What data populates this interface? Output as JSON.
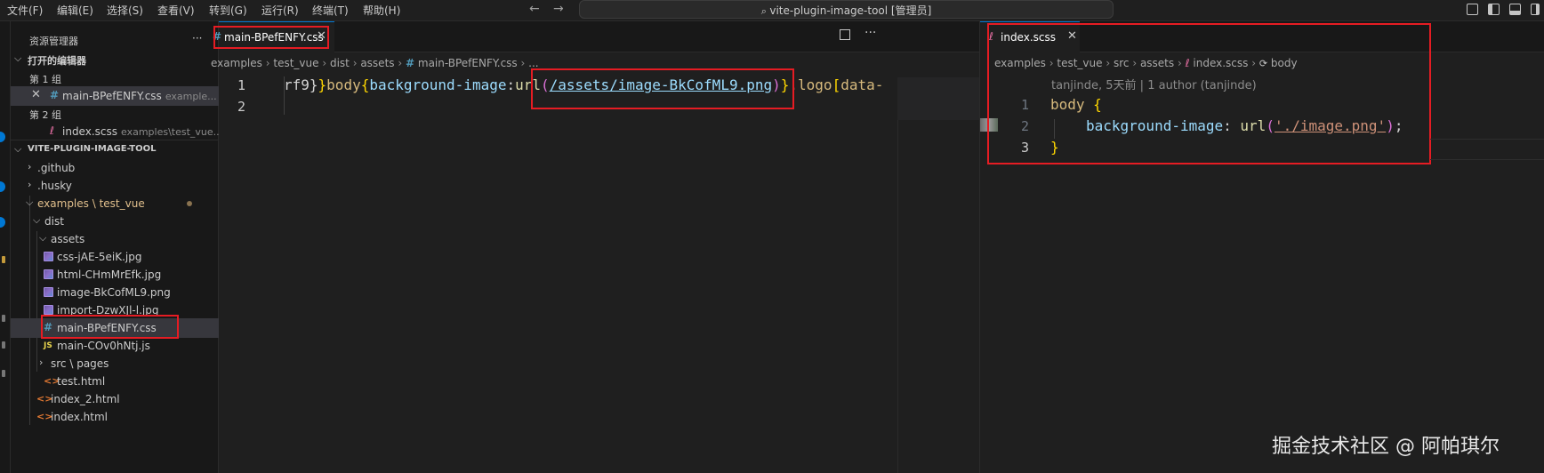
{
  "menu": [
    "文件(F)",
    "编辑(E)",
    "选择(S)",
    "查看(V)",
    "转到(G)",
    "运行(R)",
    "终端(T)",
    "帮助(H)"
  ],
  "search": {
    "label": "vite-plugin-image-tool [管理员]"
  },
  "sidebar": {
    "title": "资源管理器",
    "more": "···",
    "open_editors": "打开的编辑器",
    "group1": "第 1 组",
    "group1_file": "main-BPefENFY.css",
    "group1_desc": "example...",
    "group2": "第 2 组",
    "group2_file": "index.scss",
    "group2_desc": "examples\\test_vue...",
    "project": "VITE-PLUGIN-IMAGE-TOOL",
    "tree": {
      "github": ".github",
      "husky": ".husky",
      "examples": "examples",
      "test_vue": "test_vue",
      "dist": "dist",
      "assets": "assets",
      "f1": "css-jAE-5eiK.jpg",
      "f2": "html-CHmMrEfk.jpg",
      "f3": "image-BkCofML9.png",
      "f4": "import-DzwXJl-l.jpg",
      "f5": "main-BPefENFY.css",
      "f6": "main-COv0hNtj.js",
      "src": "src",
      "pages": "pages",
      "f7": "test.html",
      "f8": "index_2.html",
      "f9": "index.html"
    }
  },
  "editor1": {
    "tab": "main-BPefENFY.css",
    "breadcrumb": [
      "examples",
      "test_vue",
      "dist",
      "assets",
      "main-BPefENFY.css",
      "..."
    ],
    "lines": [
      "1",
      "2"
    ],
    "code": {
      "t1": "rf9}",
      "t2": "}",
      "t3": "body",
      "t4": "{",
      "t5": "background-image",
      "t6": ":",
      "t7": "url",
      "t8": "(",
      "t9": "/assets/image-BkCofML9.png",
      "t10": ")",
      "t11": "}",
      "t12": ".logo",
      "t13": "[",
      "t14": "data-"
    }
  },
  "editor2": {
    "tab": "index.scss",
    "breadcrumb": [
      "examples",
      "test_vue",
      "src",
      "assets",
      "index.scss",
      "body"
    ],
    "blame": "tanjinde, 5天前 | 1 author (tanjinde)",
    "lines": [
      "1",
      "2",
      "3"
    ],
    "code": {
      "l1a": "body",
      "l1b": "{",
      "l2a": "background-image",
      "l2b": ":",
      "l2c": "url",
      "l2d": "(",
      "l2e": "'./image.png'",
      "l2f": ")",
      "l2g": ";",
      "l3": "}"
    }
  },
  "watermark": "掘金技术社区 @ 阿帕琪尔"
}
